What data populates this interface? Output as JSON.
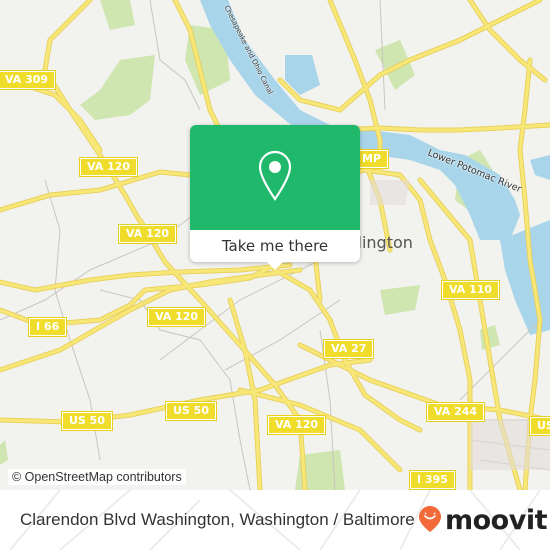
{
  "map": {
    "shields": [
      {
        "label": "VA 309",
        "name": "shield-va-309"
      },
      {
        "label": "VA 120",
        "name": "shield-va-120-north"
      },
      {
        "label": "VA 120",
        "name": "shield-va-120-west"
      },
      {
        "label": "VA 120",
        "name": "shield-va-120-center"
      },
      {
        "label": "I 66",
        "name": "shield-i-66"
      },
      {
        "label": "US 50",
        "name": "shield-us-50-west"
      },
      {
        "label": "US 50",
        "name": "shield-us-50-center"
      },
      {
        "label": "VA 120",
        "name": "shield-va-120-south"
      },
      {
        "label": "VA 27",
        "name": "shield-va-27"
      },
      {
        "label": "VA 110",
        "name": "shield-va-110"
      },
      {
        "label": "VA 244",
        "name": "shield-va-244"
      },
      {
        "label": "I 395",
        "name": "shield-i-395"
      },
      {
        "label": "US",
        "name": "shield-us-east"
      },
      {
        "label": "MP",
        "name": "shield-gw-parkway"
      }
    ],
    "labels": {
      "river": "Lower Potomac River",
      "canal": "Chesapeake and Ohio Canal",
      "place": "Arlington"
    },
    "attribution": "© OpenStreetMap contributors",
    "colors": {
      "land": "#f2f2ef",
      "water": "#a9d5ea",
      "park": "#c8e3a6",
      "road": "#f5e36b"
    }
  },
  "popup": {
    "button_label": "Take me there",
    "icon": "map-pin-icon",
    "accent": "#20b86a"
  },
  "footer": {
    "title": "Clarendon Blvd Washington, Washington / Baltimore",
    "brand": "moovit",
    "brand_color": "#f26a3a"
  }
}
